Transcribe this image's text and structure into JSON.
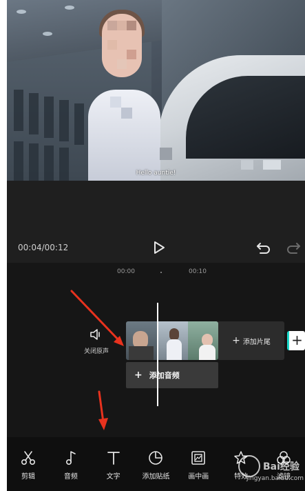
{
  "preview": {
    "subtitle": "Hello auntie!"
  },
  "player": {
    "time": "00:04/00:12"
  },
  "timeline": {
    "ruler": [
      "00:00",
      "00:10"
    ],
    "mute_label": "关闭原声",
    "add_end_label": "添加片尾",
    "add_audio_label": "添加音频"
  },
  "toolbar": {
    "items": [
      {
        "label": "剪辑",
        "icon": "scissors-icon"
      },
      {
        "label": "音频",
        "icon": "music-note-icon"
      },
      {
        "label": "文字",
        "icon": "text-icon"
      },
      {
        "label": "添加贴纸",
        "icon": "sticker-icon"
      },
      {
        "label": "画中画",
        "icon": "picture-in-picture-icon"
      },
      {
        "label": "特效",
        "icon": "star-icon"
      },
      {
        "label": "滤镜",
        "icon": "filter-icon"
      }
    ]
  },
  "watermark": {
    "brand": "Bai经验",
    "domain": "jingyan.baidu.com"
  },
  "colors": {
    "accent": "#1ad6c8",
    "arrow": "#e8321e"
  }
}
